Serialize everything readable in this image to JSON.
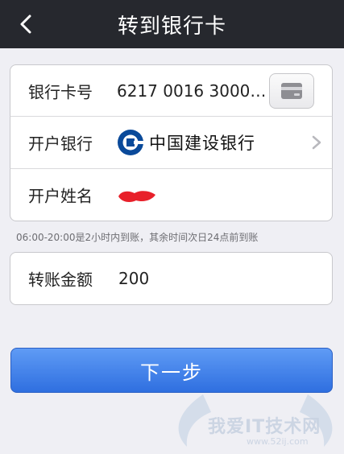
{
  "header": {
    "title": "转到银行卡",
    "back_icon": "chevron-left-icon"
  },
  "form": {
    "card_number": {
      "label": "银行卡号",
      "value": "6217 0016 3000…",
      "card_icon": "credit-card-icon"
    },
    "bank": {
      "label": "开户银行",
      "logo_icon": "ccb-logo-icon",
      "name": "中国建设银行",
      "chevron_icon": "chevron-right-icon"
    },
    "account_name": {
      "label": "开户姓名",
      "value_redacted": true
    },
    "note": "06:00-20:00是2小时内到账，其余时间次日24点前到账",
    "amount": {
      "label": "转账金额",
      "value": "200"
    }
  },
  "actions": {
    "next_label": "下一步"
  },
  "watermark": {
    "text": "我爱IT技术网",
    "url": "www.52ij.com"
  },
  "colors": {
    "navbar": "#26282e",
    "background": "#efeff4",
    "button_blue": "#2f6fe0",
    "redaction": "#e8202a",
    "ccb_blue": "#0a4a9a"
  }
}
